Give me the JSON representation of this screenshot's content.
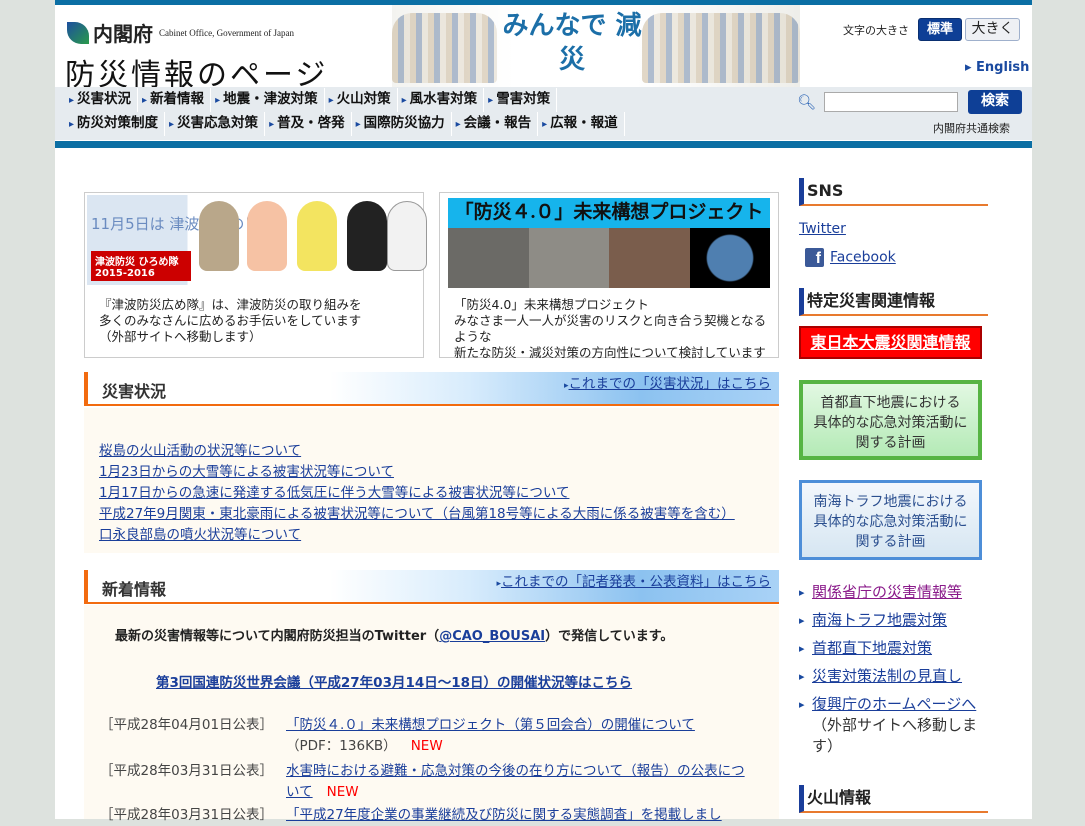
{
  "header": {
    "org_name": "内閣府",
    "org_name_en": "Cabinet Office, Government of Japan",
    "site_title": "防災情報のページ",
    "banner_text": "みんなで 減災",
    "font_size_label": "文字の大きさ",
    "font_size_standard": "標準",
    "font_size_large": "大きく",
    "english_link": "▸ English"
  },
  "nav": {
    "row1": [
      "災害状況",
      "新着情報",
      "地震・津波対策",
      "火山対策",
      "風水害対策",
      "雪害対策"
    ],
    "row2": [
      "防災対策制度",
      "災害応急対策",
      "普及・啓発",
      "国際防災協力",
      "会議・報告",
      "広報・報道"
    ]
  },
  "search": {
    "value": "",
    "button": "検索",
    "note": "内閣府共通検索",
    "icon": "search-icon"
  },
  "promos": [
    {
      "image_text": "11月5日は 津波防災の日",
      "image_badge": "津波防災 ひろめ隊 2015-2016",
      "caption": [
        "『津波防災広め隊』は、津波防災の取り組みを",
        "多くのみなさんに広めるお手伝いをしています",
        "（外部サイトへ移動します）"
      ]
    },
    {
      "image_title": "「防災４.０」未来構想プロジェクト",
      "caption": [
        "「防災4.0」未来構想プロジェクト",
        "みなさま一人一人が災害のリスクと向き合う契機となるような",
        "新たな防災・減災対策の方向性について検討しています"
      ]
    }
  ],
  "disaster": {
    "title": "災害状況",
    "more": "これまでの「災害状況」はこちら",
    "items": [
      "桜島の火山活動の状況等について",
      "1月23日からの大雪等による被害状況等について",
      "1月17日からの急速に発達する低気圧に伴う大雪等による被害状況等について",
      "平成27年9月関東・東北豪雨による被害状況等について（台風第18号等による大雨に係る被害等を含む）",
      "口永良部島の噴火状況等について"
    ]
  },
  "news": {
    "title": "新着情報",
    "more": "これまでの「記者発表・公表資料」はこちら",
    "twitter_pre": "最新の災害情報等について内閣府防災担当のTwitter（",
    "twitter_handle": "@CAO_BOUSAI",
    "twitter_post": "）で発信しています。",
    "wcdrr": "第3回国連防災世界会議（平成27年03月14日～18日）の開催状況等はこちら",
    "items": [
      {
        "date": "［平成28年04月01日公表］",
        "title": "「防災４.０」未来構想プロジェクト（第５回会合）の開催について",
        "note": "（PDF：136KB）",
        "badge": "NEW"
      },
      {
        "date": "［平成28年03月31日公表］",
        "title": "水害時における避難・応急対策の今後の在り方について（報告）の公表について",
        "note": "",
        "badge": "NEW"
      },
      {
        "date": "［平成28年03月31日公表］",
        "title": "「平成27年度企業の事業継続及び防災に関する実態調査」を掲載しまし",
        "note": "",
        "badge": ""
      }
    ]
  },
  "sidebar": {
    "sns_title": "SNS",
    "twitter": "Twitter",
    "facebook": "Facebook",
    "special_title": "特定災害関連情報",
    "earthquake_button": "東日本大震災関連情報",
    "plan1": [
      "首都直下地震における",
      "具体的な応急対策活動に",
      "関する計画"
    ],
    "plan2": [
      "南海トラフ地震における",
      "具体的な応急対策活動に",
      "関する計画"
    ],
    "links": [
      "関係省庁の災害情報等",
      "南海トラフ地震対策",
      "首都直下地震対策",
      "災害対策法制の見直し",
      "復興庁のホームページへ"
    ],
    "links_note": "（外部サイトへ移動します）",
    "volcano_title": "火山情報"
  },
  "colors": {
    "brand_blue": "#0b6fa4",
    "accent_orange": "#f26b0f",
    "link": "#1a3e9a",
    "visited": "#8a1a8a",
    "new_red": "#ff0000"
  }
}
